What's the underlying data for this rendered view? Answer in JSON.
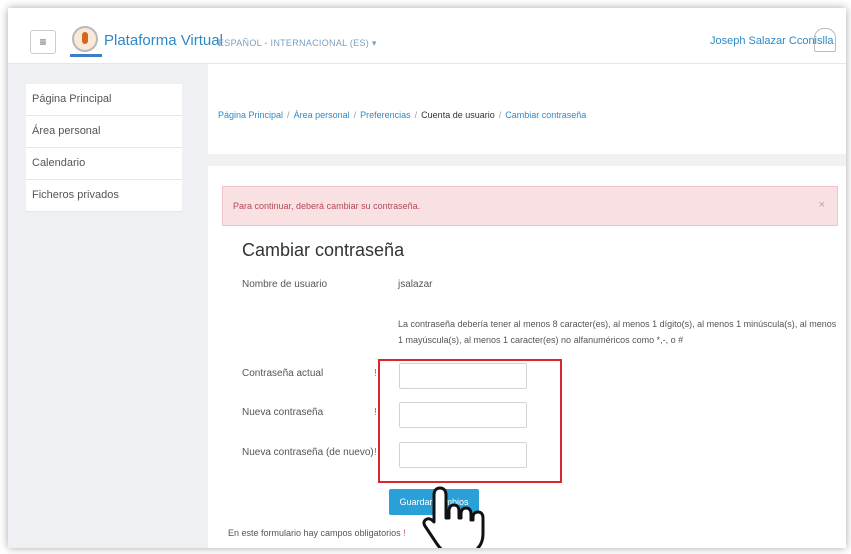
{
  "navbar": {
    "menu_icon": "hamburger-icon",
    "brand": "Plataforma Virtual",
    "language": "ESPAÑOL - INTERNACIONAL (ES) ▾",
    "user_name": "Joseph Salazar Cconislla"
  },
  "sidebar": {
    "items": [
      {
        "label": "Página Principal"
      },
      {
        "label": "Área personal"
      },
      {
        "label": "Calendario"
      },
      {
        "label": "Ficheros privados"
      }
    ]
  },
  "breadcrumb": {
    "items": [
      "Página Principal",
      "Área personal",
      "Preferencias",
      "Cuenta de usuario",
      "Cambiar contraseña"
    ],
    "separator": "/"
  },
  "alert": {
    "message": "Para continuar, deberá cambiar su contraseña.",
    "close": "×"
  },
  "form": {
    "title": "Cambiar contraseña",
    "username_label": "Nombre de usuario",
    "username_value": "jsalazar",
    "help_text": "La contraseña debería tener al menos 8 caracter(es), al menos 1 dígito(s), al menos 1 minúscula(s), al menos 1 mayúscula(s), al menos 1 caracter(es) no alfanuméricos como *,-, o #",
    "current_password_label": "Contraseña actual",
    "new_password_label": "Nueva contraseña",
    "new_password_again_label": "Nueva contraseña (de nuevo)",
    "required_marker": "!",
    "save_button": "Guardar cambios",
    "required_note": "En este formulario hay campos obligatorios"
  },
  "colors": {
    "accent": "#2c8ac6",
    "alert_bg": "#f9e0e3",
    "highlight": "#d9272e",
    "button": "#2aa0d9"
  }
}
